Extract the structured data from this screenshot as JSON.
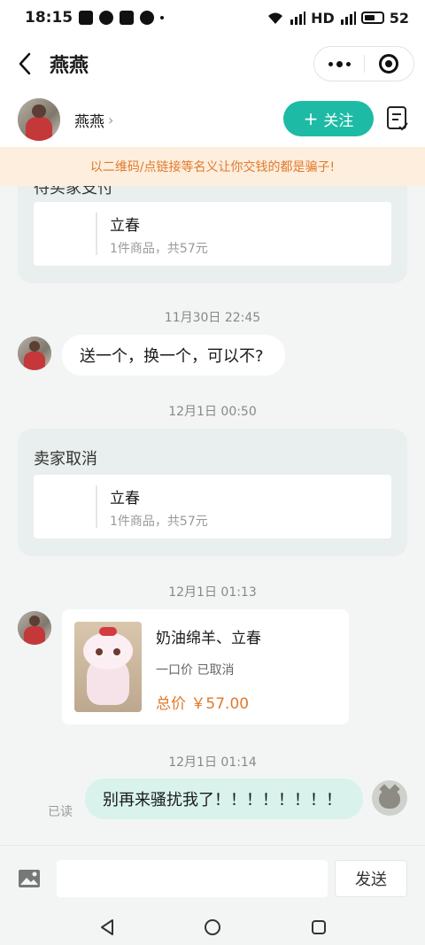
{
  "status_bar": {
    "time": "18:15",
    "network_1": "HD",
    "battery": "52"
  },
  "nav": {
    "title": "燕燕"
  },
  "profile": {
    "name": "燕燕",
    "follow_label": "关注"
  },
  "warning": {
    "text": "以二维码/点链接等名义让你交钱的都是骗子!"
  },
  "messages": {
    "card1": {
      "title_partial": "待买家支付",
      "item_title": "立春",
      "item_sub": "1件商品，共57元"
    },
    "ts1": "11月30日 22:45",
    "msg1": "送一个，换一个，可以不?",
    "ts2": "12月1日 00:50",
    "card2": {
      "title": "卖家取消",
      "item_title": "立春",
      "item_sub": "1件商品，共57元"
    },
    "ts3": "12月1日 01:13",
    "product": {
      "title": "奶油绵羊、立春",
      "status": "一口价 已取消",
      "price": "总价 ￥57.00"
    },
    "ts4": "12月1日 01:14",
    "read_label": "已读",
    "msg2": "别再来骚扰我了！！！！！！！！"
  },
  "input": {
    "placeholder": "",
    "send_label": "发送"
  },
  "colors": {
    "accent": "#1dbba5",
    "warning_text": "#e07a2c",
    "warning_bg": "#fdeedd",
    "bubble_me": "#d9f2ec"
  }
}
